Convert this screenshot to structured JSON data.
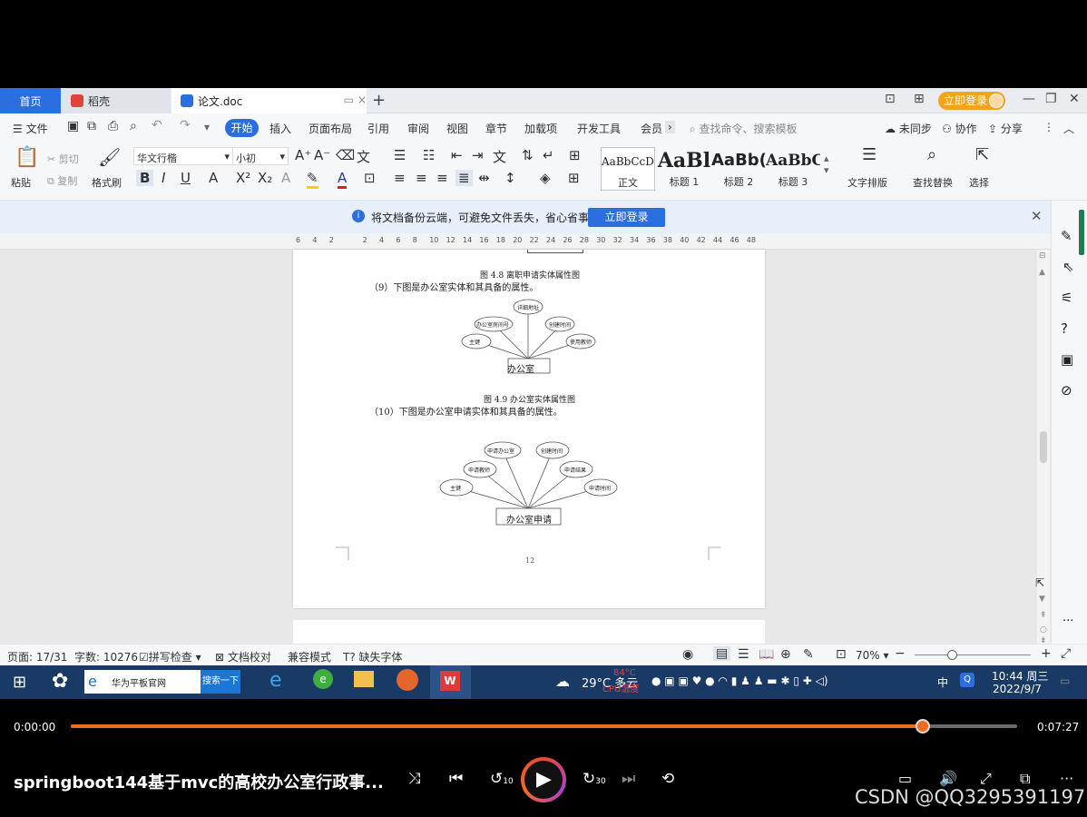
{
  "tabs": {
    "home": "首页",
    "daoke": "稻壳",
    "doc": "论文.doc"
  },
  "window": {
    "login": "立即登录",
    "new_tab": "+"
  },
  "menu": {
    "file": "文件",
    "start": "开始",
    "insert": "插入",
    "layout": "页面布局",
    "reference": "引用",
    "review": "审阅",
    "view": "视图",
    "chapter": "章节",
    "addins": "加载项",
    "devtools": "开发工具",
    "member": "会员",
    "more": "›",
    "search": "查找命令、搜索模板",
    "unsync": "未同步",
    "collab": "协作",
    "share": "分享"
  },
  "ribbon": {
    "paste": "粘贴",
    "cut": "剪切",
    "copy": "复制",
    "format_painter": "格式刷",
    "font": "华文行楷",
    "size": "小初",
    "style_normal": "正文",
    "style_h1": "标题 1",
    "style_h2": "标题 2",
    "style_h3": "标题 3",
    "sample_normal": "AaBbCcDd",
    "sample_h1": "AaBl",
    "sample_h2": "AaBb(",
    "sample_h3": "AaBbC",
    "text_layout": "文字排版",
    "find_replace": "查找替换",
    "select": "选择"
  },
  "notice": {
    "text": "将文档备份云端，可避免文件丢失，省心省事",
    "button": "立即登录"
  },
  "ruler": [
    "6",
    "4",
    "2",
    "",
    "2",
    "4",
    "6",
    "8",
    "10",
    "12",
    "14",
    "16",
    "18",
    "20",
    "22",
    "24",
    "26",
    "28",
    "30",
    "32",
    "34",
    "36",
    "38",
    "40",
    "42",
    "44",
    "46",
    "48"
  ],
  "document": {
    "caption_48": "图 4.8 离职申请实体属性图",
    "para_9": "（9）下图是办公室实体和其具备的属性。",
    "office_entity": "办公室",
    "office_attrs": [
      "主键",
      "办公室房间号",
      "详细地址",
      "创建时间",
      "使用教师"
    ],
    "caption_49": "图 4.9 办公室实体属性图",
    "para_10": "（10）下图是办公室申请实体和其具备的属性。",
    "apply_entity": "办公室申请",
    "apply_attrs": [
      "主键",
      "申请教师",
      "申请办公室",
      "创建时间",
      "申请结果",
      "申请时间"
    ],
    "page_num": "12"
  },
  "status": {
    "page": "页面: 17/31",
    "words": "字数: 10276",
    "spell": "拼写检查",
    "proof": "文档校对",
    "compat": "兼容模式",
    "missing_font": "缺失字体",
    "zoom": "70%"
  },
  "taskbar": {
    "search_text": "华为平板官网",
    "search_btn": "搜索一下",
    "weather": "29°C 多云",
    "cpu_temp": "84°C",
    "cpu_label": "CPU温度",
    "ime": "中",
    "time": "10:44 周三",
    "date": "2022/9/7"
  },
  "video": {
    "elapsed": "0:00:00",
    "duration": "0:07:27",
    "progress": 0.9,
    "title": "springboot144基于mvc的高校办公室行政事...",
    "rewind": "10",
    "forward": "30",
    "watermark": "CSDN @QQ3295391197"
  }
}
